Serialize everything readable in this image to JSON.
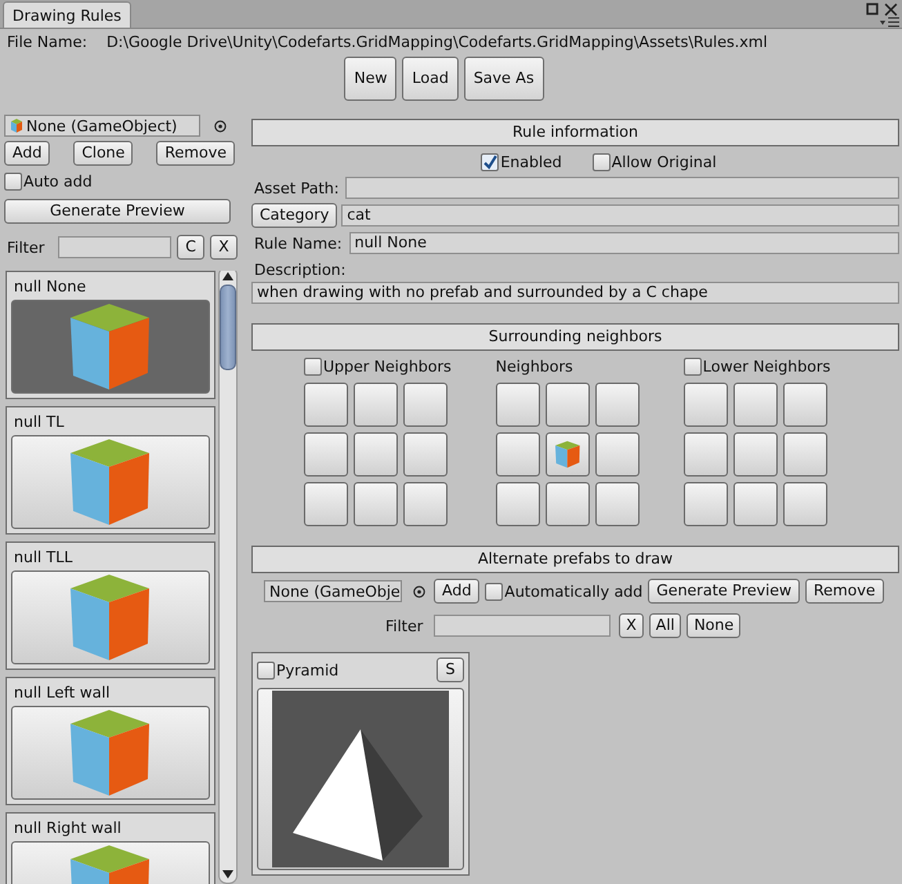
{
  "tab": {
    "label": "Drawing Rules",
    "selected": true
  },
  "file": {
    "label": "File Name:",
    "path": "D:\\Google Drive\\Unity\\Codefarts.GridMapping\\Codefarts.GridMapping\\Assets\\Rules.xml"
  },
  "file_buttons": [
    "New",
    "Load",
    "Save As"
  ],
  "left": {
    "object_field": "None (GameObject)",
    "buttons": [
      "Add",
      "Clone",
      "Remove"
    ],
    "auto_add": {
      "label": "Auto add",
      "checked": false
    },
    "generate_preview": "Generate Preview",
    "filter": {
      "label": "Filter",
      "buttons": [
        "C",
        "X"
      ]
    },
    "rules": [
      {
        "name": "null None",
        "selected": true
      },
      {
        "name": "null TL",
        "selected": false
      },
      {
        "name": "null TLL",
        "selected": false
      },
      {
        "name": "null Left wall",
        "selected": false
      },
      {
        "name": "null Right wall",
        "selected": false
      }
    ]
  },
  "rule_info": {
    "header": "Rule information",
    "options": [
      {
        "label": "Enabled",
        "checked": true
      },
      {
        "label": "Allow Original",
        "checked": false
      }
    ],
    "asset_path": {
      "label": "Asset Path:"
    },
    "category": {
      "button": "Category",
      "value": "cat"
    },
    "rule_name": {
      "label": "Rule Name:",
      "value": "null None"
    },
    "description": {
      "label": "Description:",
      "value": "when drawing with no prefab and surrounded by a C chape"
    }
  },
  "neighbors": {
    "header": "Surrounding neighbors",
    "groups": [
      {
        "kind": "checkbox",
        "label": "Upper Neighbors",
        "checked": false,
        "cells": [
          false,
          false,
          false,
          false,
          false,
          false,
          false,
          false,
          false
        ]
      },
      {
        "kind": "label",
        "label": "Neighbors",
        "cells": [
          false,
          false,
          false,
          false,
          true,
          false,
          false,
          false,
          false
        ]
      },
      {
        "kind": "checkbox",
        "label": "Lower Neighbors",
        "checked": false,
        "cells": [
          false,
          false,
          false,
          false,
          false,
          false,
          false,
          false,
          false
        ]
      }
    ]
  },
  "alternates": {
    "header": "Alternate prefabs to draw",
    "object_field": "None (GameObje",
    "add": "Add",
    "auto_add": {
      "label": "Automatically add",
      "checked": false
    },
    "buttons": [
      "Generate Preview",
      "Remove"
    ],
    "filter": {
      "label": "Filter",
      "buttons": [
        "X",
        "All",
        "None"
      ]
    },
    "prefabs": [
      {
        "name": "Pyramid",
        "checked": false,
        "button": "S"
      }
    ]
  }
}
